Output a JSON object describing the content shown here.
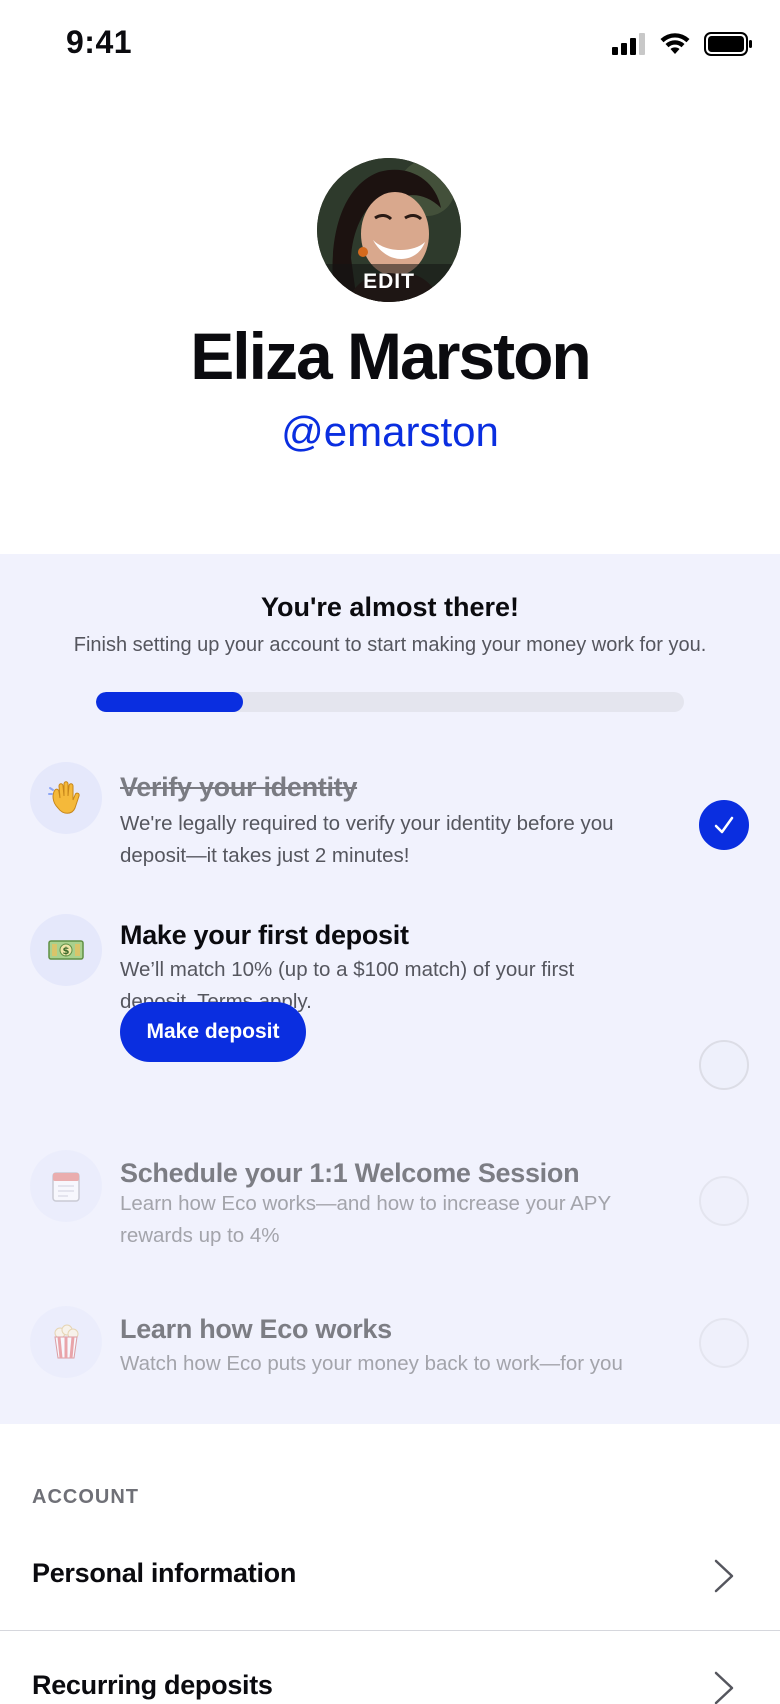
{
  "status_bar": {
    "time": "9:41"
  },
  "profile": {
    "avatar_edit_label": "EDIT",
    "name": "Eliza Marston",
    "handle": "@emarston"
  },
  "onboarding": {
    "title": "You're almost there!",
    "subtitle": "Finish setting up your account to start making your money work for you.",
    "progress_fraction": 0.25,
    "accent_color": "#0a2ee0",
    "tasks": [
      {
        "icon": "waving-hand-icon",
        "title": "Verify your identity",
        "description": "We're legally required to verify your identity before you deposit—it takes just 2 minutes!",
        "completed": true
      },
      {
        "icon": "dollar-banknote-icon",
        "title": "Make your first deposit",
        "description": "We’ll match 10% (up to a $100 match) of your first deposit. Terms apply.",
        "completed": false,
        "button_label": "Make deposit"
      },
      {
        "icon": "calendar-icon",
        "title": "Schedule your 1:1 Welcome Session",
        "description": "Learn how Eco works—and how to increase your APY rewards up to 4%",
        "completed": false
      },
      {
        "icon": "popcorn-icon",
        "title": "Learn how Eco works",
        "description": "Watch how Eco puts your money back to work—for you",
        "completed": false
      }
    ]
  },
  "account": {
    "section_label": "ACCOUNT",
    "items": [
      {
        "label": "Personal information"
      },
      {
        "label": "Recurring deposits"
      }
    ]
  }
}
